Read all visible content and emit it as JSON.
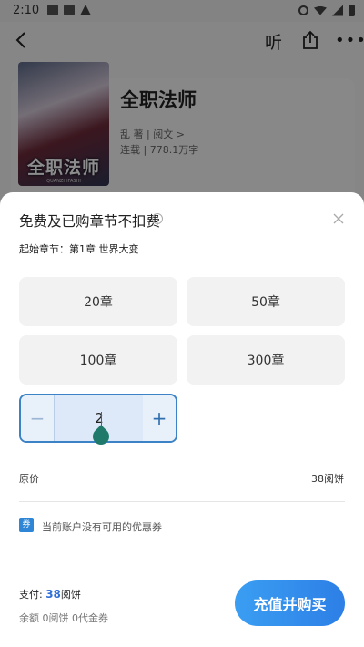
{
  "status_bar": {
    "time": "2:10"
  },
  "header": {
    "listen_label": "听"
  },
  "book": {
    "title": "全职法师",
    "author_line": "乱 著 | 阅文 >",
    "status_line": "连载 | 778.1万字",
    "cover_title": "全职法师",
    "cover_subtitle": "QUANZHIFASHI"
  },
  "sheet": {
    "title": "免费及已购章节不扣费",
    "start_chapter": "起始章节：第1章 世界大变",
    "options": [
      "20章",
      "50章",
      "100章",
      "300章"
    ],
    "stepper": {
      "minus": "−",
      "value": "2",
      "plus": "+"
    },
    "price_label": "原价",
    "price_value": "38阅饼",
    "coupon_badge": "券",
    "coupon_text": "当前账户没有可用的优惠券",
    "pay_label": "支付: ",
    "pay_amount": "38",
    "pay_unit": "阅饼",
    "balance_text": "余额 0阅饼 0代金券",
    "buy_button": "充值并购买"
  },
  "colors": {
    "accent": "#2f86d6",
    "button": "#2d7fe6",
    "stepper_border": "#3b82c6"
  }
}
